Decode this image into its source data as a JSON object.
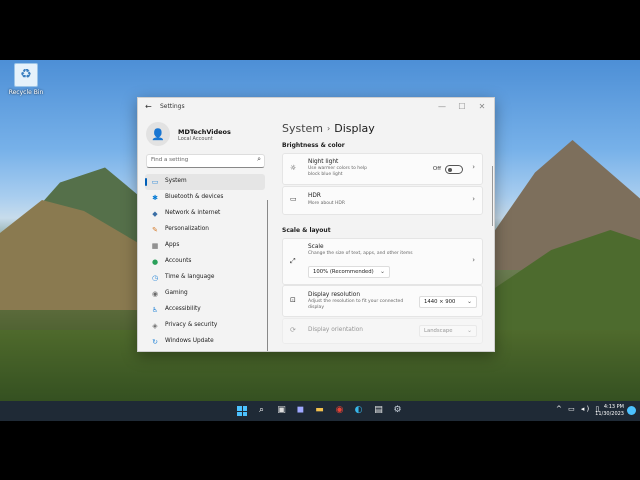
{
  "desktop": {
    "icons": [
      {
        "label": "Recycle Bin",
        "icon": "recycle-bin-icon"
      }
    ]
  },
  "window": {
    "title": "Settings",
    "back": "←",
    "minimize": "—",
    "maximize": "☐",
    "close": "✕"
  },
  "profile": {
    "name": "MDTechVideos",
    "account": "Local Account",
    "icon": "user-icon"
  },
  "search": {
    "placeholder": "Find a setting",
    "icon": "⌕"
  },
  "nav": [
    {
      "label": "System",
      "icon": "monitor-icon",
      "glyph": "▭",
      "color": "#2b88d8",
      "selected": true
    },
    {
      "label": "Bluetooth & devices",
      "icon": "bluetooth-icon",
      "glyph": "✱",
      "color": "#0078d4"
    },
    {
      "label": "Network & internet",
      "icon": "wifi-icon",
      "glyph": "◆",
      "color": "#3a6ea5"
    },
    {
      "label": "Personalization",
      "icon": "brush-icon",
      "glyph": "✎",
      "color": "#d47a2a"
    },
    {
      "label": "Apps",
      "icon": "apps-icon",
      "glyph": "▦",
      "color": "#5a5a5a"
    },
    {
      "label": "Accounts",
      "icon": "accounts-icon",
      "glyph": "●",
      "color": "#2aa05a"
    },
    {
      "label": "Time & language",
      "icon": "clock-icon",
      "glyph": "◷",
      "color": "#2b88d8"
    },
    {
      "label": "Gaming",
      "icon": "gamepad-icon",
      "glyph": "◉",
      "color": "#6a6a6a"
    },
    {
      "label": "Accessibility",
      "icon": "accessibility-icon",
      "glyph": "♿",
      "color": "#2b88d8"
    },
    {
      "label": "Privacy & security",
      "icon": "shield-icon",
      "glyph": "◈",
      "color": "#707070"
    },
    {
      "label": "Windows Update",
      "icon": "update-icon",
      "glyph": "↻",
      "color": "#2b88d8"
    }
  ],
  "main": {
    "breadcrumb_parent": "System",
    "breadcrumb_sep": "›",
    "breadcrumb_current": "Display",
    "sections": {
      "brightness": "Brightness & color",
      "scale": "Scale & layout"
    },
    "night_light": {
      "title": "Night light",
      "desc": "Use warmer colors to help block blue light",
      "toggle_label": "Off",
      "icon": "sun-icon",
      "glyph": "☼"
    },
    "hdr": {
      "title": "HDR",
      "link": "More about HDR",
      "icon": "hdr-icon",
      "glyph": "▭"
    },
    "scale": {
      "title": "Scale",
      "desc": "Change the size of text, apps, and other items",
      "value": "100% (Recommended)",
      "icon": "scale-icon",
      "glyph": "⤢"
    },
    "resolution": {
      "title": "Display resolution",
      "desc": "Adjust the resolution to fit your connected display",
      "value": "1440 × 900",
      "icon": "resolution-icon",
      "glyph": "⊡"
    },
    "orientation": {
      "title": "Display orientation",
      "value": "Landscape",
      "icon": "orientation-icon",
      "glyph": "⟳"
    },
    "chevron": "›",
    "dropdown_arrow": "⌄"
  },
  "taskbar": {
    "time": "4:13 PM",
    "date": "11/30/2023",
    "tray": "^ ▭ ◂) ▯"
  }
}
